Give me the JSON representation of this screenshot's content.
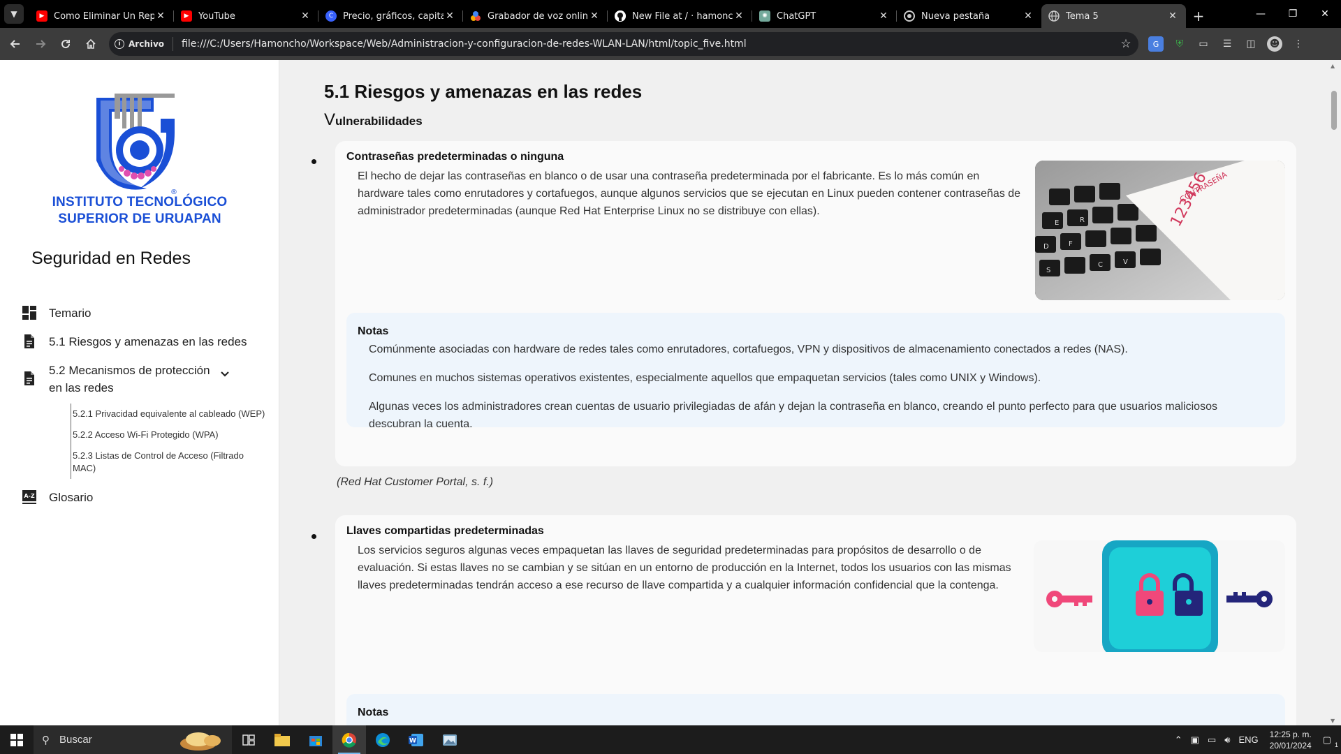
{
  "browser": {
    "tabs": [
      {
        "title": "Como Eliminar Un Reposi",
        "favicon": "youtube-icon",
        "color": "#ff0000"
      },
      {
        "title": "YouTube",
        "favicon": "youtube-icon",
        "color": "#ff0000"
      },
      {
        "title": "Precio, gráficos, capitaliza",
        "favicon": "coinmarketcap-icon",
        "color": "#3861fb"
      },
      {
        "title": "Grabador de voz online -",
        "favicon": "recorder-icon",
        "color": "#f6a800"
      },
      {
        "title": "New File at / · hamoncho/",
        "favicon": "github-icon",
        "color": "#ffffff"
      },
      {
        "title": "ChatGPT",
        "favicon": "chatgpt-icon",
        "color": "#74aa9c"
      },
      {
        "title": "Nueva pestaña",
        "favicon": "chrome-icon",
        "color": "#cccccc"
      },
      {
        "title": "Tema 5",
        "favicon": "globe-icon",
        "color": "#cccccc",
        "active": true
      }
    ],
    "security_chip": "Archivo",
    "url": "file:///C:/Users/Hamoncho/Workspace/Web/Administracion-y-configuracion-de-redes-WLAN-LAN/html/topic_five.html"
  },
  "sidebar": {
    "institute_line1": "INSTITUTO TECNOLÓGICO",
    "institute_line2": "SUPERIOR DE URUAPAN",
    "site_title": "Seguridad en Redes",
    "items": [
      {
        "label": "Temario",
        "icon": "dashboard-icon"
      },
      {
        "label": "5.1 Riesgos y amenazas en las redes",
        "icon": "document-icon"
      },
      {
        "label": "5.2 Mecanismos de protección en las redes",
        "icon": "document-icon"
      },
      {
        "label": "Glosario",
        "icon": "glossary-icon"
      }
    ],
    "subitems": [
      "5.2.1 Privacidad equivalente al cableado (WEP)",
      "5.2.2 Acceso Wi-Fi Protegido (WPA)",
      "5.2.3 Listas de Control de Acceso (Filtrado MAC)"
    ]
  },
  "main": {
    "title": "5.1 Riesgos y amenazas en las redes",
    "subtitle_first": "V",
    "subtitle_rest": "ulnerabilidades",
    "card1": {
      "title": "Contraseñas predeterminadas o ninguna",
      "body": "El hecho de dejar las contraseñas en blanco o de usar una contraseña predeterminada por el fabricante. Es lo más común en hardware tales como enrutadores y cortafuegos, aunque algunos servicios que se ejecutan en Linux pueden contener contraseñas de administrador predeterminadas (aunque Red Hat Enterprise Linux no se distribuye con ellas).",
      "image_text_1": "CONTRASEÑA",
      "image_text_2": "123456",
      "notes_title": "Notas",
      "notes": [
        "Comúnmente asociadas con hardware de redes tales como enrutadores, cortafuegos, VPN y dispositivos de almacenamiento conectados a redes (NAS).",
        "Comunes en muchos sistemas operativos existentes, especialmente aquellos que empaquetan servicios (tales como UNIX y Windows).",
        "Algunas veces los administradores crean cuentas de usuario privilegiadas de afán y dejan la contraseña en blanco, creando el punto perfecto para que usuarios maliciosos descubran la cuenta."
      ]
    },
    "citation": "(Red Hat Customer Portal, s. f.)",
    "card2": {
      "title": "Llaves compartidas predeterminadas",
      "body": "Los servicios seguros algunas veces empaquetan las llaves de seguridad predeterminadas para propósitos de desarrollo o de evaluación. Si estas llaves no se cambian y se sitúan en un entorno de producción en la Internet, todos los usuarios con las mismas llaves predeterminadas tendrán acceso a ese recurso de llave compartida y a cualquier información confidencial que la contenga.",
      "notes_title": "Notas"
    }
  },
  "taskbar": {
    "search_placeholder": "Buscar",
    "language": "ENG",
    "time": "12:25 p. m.",
    "date": "20/01/2024",
    "notification_count": "1"
  },
  "colors": {
    "brand_blue": "#1a4fd6",
    "notes_bg": "#eef5fc",
    "key_pink": "#f0487a",
    "key_navy": "#24257a",
    "lock_box": "#1ec1d6"
  }
}
